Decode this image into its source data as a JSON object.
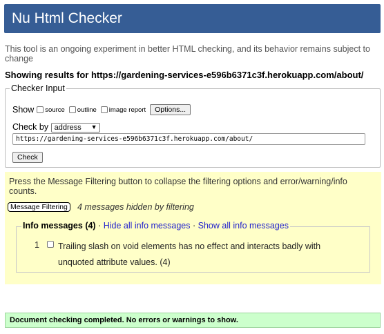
{
  "header": {
    "title": "Nu Html Checker"
  },
  "intro": "This tool is an ongoing experiment in better HTML checking, and its behavior remains subject to change",
  "showing": "Showing results for https://gardening-services-e596b6371c3f.herokuapp.com/about/",
  "checker_input": {
    "legend": "Checker Input",
    "show_label": "Show",
    "options": [
      "source",
      "outline",
      "image report"
    ],
    "options_button": "Options...",
    "check_by_label": "Check by",
    "check_by_value": "address",
    "url_value": "https://gardening-services-e596b6371c3f.herokuapp.com/about/",
    "check_button": "Check"
  },
  "filtering": {
    "text": "Press the Message Filtering button to collapse the filtering options and error/warning/info counts.",
    "button": "Message Filtering",
    "hidden_note": "4 messages hidden by filtering",
    "info_label": "Info messages (4)",
    "sep": "·",
    "hide_link": "Hide all info messages",
    "show_link": "Show all info messages",
    "message_num": "1",
    "message_text": "Trailing slash on void elements has no effect and interacts badly with unquoted attribute values. (4)"
  },
  "status": "Document checking completed. No errors or warnings to show.",
  "colors": {
    "header": "#365d95",
    "filter_bg": "#ffffc8",
    "success_bg": "#ccffcc",
    "link": "#2222cc"
  }
}
